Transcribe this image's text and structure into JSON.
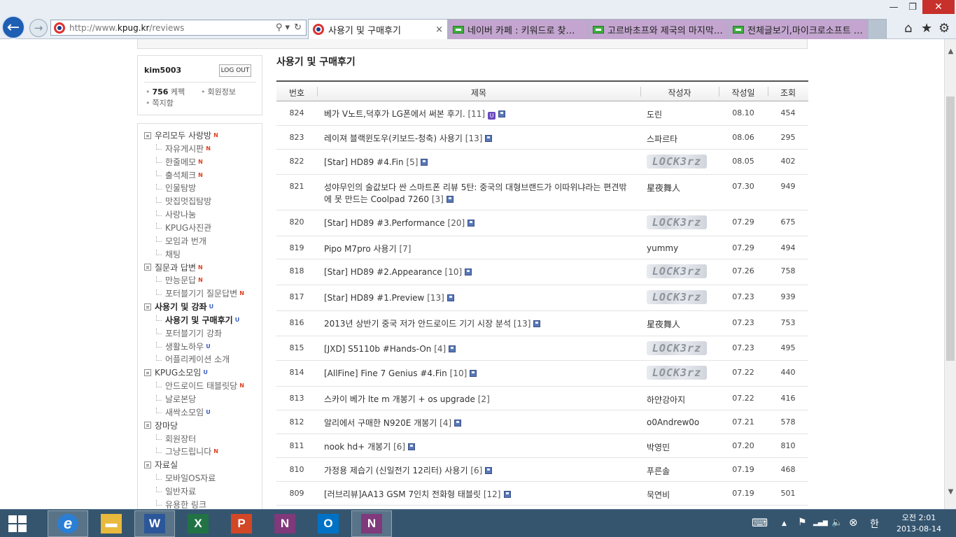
{
  "browser": {
    "url_prefix": "http://www.",
    "url_domain": "kpug.kr",
    "url_path": "/reviews",
    "addr_search_glyph": "⚲ ▾",
    "addr_refresh_glyph": "↻",
    "tabs": [
      {
        "label": "사용기 및 구매후기",
        "active": true,
        "close": "×"
      },
      {
        "label": "네이버 카페 : 키워드로 찾아라..."
      },
      {
        "label": "고르바초프와 제국의 마지막 : ..."
      },
      {
        "label": "전체글보기,마이크로소프트 공..."
      }
    ],
    "window_controls": {
      "minimize": "—",
      "maximize": "❐",
      "close": "✕"
    },
    "icons": {
      "home": "⌂",
      "favorites": "★",
      "tools": "⚙",
      "back": "←",
      "forward": "→"
    }
  },
  "login": {
    "username": "kim5003",
    "logout_label": "LOG OUT",
    "points_value": "756",
    "points_unit": " 케펙",
    "member_info": "회원정보",
    "messages": "쪽지함",
    "bullet": "•"
  },
  "sidebar": {
    "items": [
      {
        "label": "우리모두 사랑방",
        "badge": "N",
        "level": "group"
      },
      {
        "label": "자유게시판",
        "badge": "N",
        "level": "sub"
      },
      {
        "label": "한줄메모",
        "badge": "N",
        "level": "sub"
      },
      {
        "label": "출석체크",
        "badge": "N",
        "level": "sub"
      },
      {
        "label": "인물탐방",
        "badge": "",
        "level": "sub"
      },
      {
        "label": "맛집멋집탐방",
        "badge": "",
        "level": "sub"
      },
      {
        "label": "사랑나눔",
        "badge": "",
        "level": "sub"
      },
      {
        "label": "KPUG사진관",
        "badge": "",
        "level": "sub"
      },
      {
        "label": "모임과 번개",
        "badge": "",
        "level": "sub"
      },
      {
        "label": "채팅",
        "badge": "",
        "level": "sub"
      },
      {
        "label": "질문과 답변",
        "badge": "N",
        "level": "group"
      },
      {
        "label": "만능문답",
        "badge": "N",
        "level": "sub"
      },
      {
        "label": "포터블기기 질문답변",
        "badge": "N",
        "level": "sub"
      },
      {
        "label": "사용기 및 강좌",
        "badge": "U",
        "level": "group",
        "strong": true
      },
      {
        "label": "사용기 및 구매후기",
        "badge": "U",
        "level": "sub",
        "strong": true
      },
      {
        "label": "포터블기기 강좌",
        "badge": "",
        "level": "sub"
      },
      {
        "label": "생활노하우",
        "badge": "U",
        "level": "sub"
      },
      {
        "label": "어플리케이션 소개",
        "badge": "",
        "level": "sub"
      },
      {
        "label": "KPUG소모임",
        "badge": "U",
        "level": "group"
      },
      {
        "label": "안드로이드 태블릿당",
        "badge": "N",
        "level": "sub"
      },
      {
        "label": "날로본당",
        "badge": "",
        "level": "sub"
      },
      {
        "label": "새싹소모임",
        "badge": "U",
        "level": "sub"
      },
      {
        "label": "장마당",
        "badge": "",
        "level": "group"
      },
      {
        "label": "회원장터",
        "badge": "",
        "level": "sub"
      },
      {
        "label": "그냥드립니다",
        "badge": "N",
        "level": "sub"
      },
      {
        "label": "자료실",
        "badge": "",
        "level": "group"
      },
      {
        "label": "모바일OS자료",
        "badge": "",
        "level": "sub"
      },
      {
        "label": "일반자료",
        "badge": "",
        "level": "sub"
      },
      {
        "label": "유용한 링크",
        "badge": "",
        "level": "sub"
      }
    ]
  },
  "board": {
    "title": "사용기 및 구매후기",
    "columns": {
      "no": "번호",
      "subject": "제목",
      "author": "작성자",
      "date": "작성일",
      "views": "조회"
    },
    "rows": [
      {
        "no": "824",
        "subject": "베가 V노트,덕후가 LG폰에서 써본 후기.",
        "comments": "[11]",
        "ubadge": "U",
        "author": "도린",
        "date": "08.10",
        "views": "454"
      },
      {
        "no": "823",
        "subject": "레이져 블랙윈도우(키보드-청축) 사용기",
        "comments": "[13]",
        "author": "스파르타",
        "date": "08.06",
        "views": "295"
      },
      {
        "no": "822",
        "subject": "[Star] HD89 #4.Fin",
        "comments": "[5]",
        "author": "LOCK3rz",
        "author_img": true,
        "date": "08.05",
        "views": "402"
      },
      {
        "no": "821",
        "subject": "성야무인의 술값보다 싼 스마트폰 리뷰 5탄: 중국의 대형브랜드가 이따위냐라는 편견밖에 못 만드는 Coolpad 7260",
        "comments": "[3]",
        "author": "星夜舞人",
        "date": "07.30",
        "views": "949"
      },
      {
        "no": "820",
        "subject": "[Star] HD89 #3.Performance",
        "comments": "[20]",
        "author": "LOCK3rz",
        "author_img": true,
        "date": "07.29",
        "views": "675"
      },
      {
        "no": "819",
        "subject": "Pipo M7pro 사용기",
        "comments": "[7]",
        "author": "yummy",
        "date": "07.29",
        "views": "494",
        "nodisk": true
      },
      {
        "no": "818",
        "subject": "[Star] HD89 #2.Appearance",
        "comments": "[10]",
        "author": "LOCK3rz",
        "author_img": true,
        "date": "07.26",
        "views": "758"
      },
      {
        "no": "817",
        "subject": "[Star] HD89 #1.Preview",
        "comments": "[13]",
        "author": "LOCK3rz",
        "author_img": true,
        "date": "07.23",
        "views": "939"
      },
      {
        "no": "816",
        "subject": "2013년 상반기 중국 저가 안드로이드 기기 시장 분석",
        "comments": "[13]",
        "author": "星夜舞人",
        "date": "07.23",
        "views": "753"
      },
      {
        "no": "815",
        "subject": "[JXD] S5110b #Hands-On",
        "comments": "[4]",
        "author": "LOCK3rz",
        "author_img": true,
        "date": "07.23",
        "views": "495"
      },
      {
        "no": "814",
        "subject": "[AllFine] Fine 7 Genius #4.Fin",
        "comments": "[10]",
        "author": "LOCK3rz",
        "author_img": true,
        "date": "07.22",
        "views": "440"
      },
      {
        "no": "813",
        "subject": "스카이 베가 lte m 개봉기 + os upgrade",
        "comments": "[2]",
        "author": "하얀강아지",
        "date": "07.22",
        "views": "416",
        "nodisk": true
      },
      {
        "no": "812",
        "subject": "알리에서 구매한 N920E 개봉기",
        "comments": "[4]",
        "author": "o0Andrew0o",
        "date": "07.21",
        "views": "578"
      },
      {
        "no": "811",
        "subject": "nook hd+ 개봉기",
        "comments": "[6]",
        "author": "박영민",
        "date": "07.20",
        "views": "810"
      },
      {
        "no": "810",
        "subject": "가정용 제습기 (신일전기 12리터) 사용기",
        "comments": "[6]",
        "author": "푸른솔",
        "date": "07.19",
        "views": "468"
      },
      {
        "no": "809",
        "subject": "[러브리뷰]AA13 GSM 7인치 전화형 태블릿",
        "comments": "[12]",
        "author": "묵연비",
        "date": "07.19",
        "views": "501"
      }
    ]
  },
  "taskbar": {
    "apps": [
      {
        "name": "internet-explorer",
        "glyph": "e",
        "open": true,
        "color": "#2a7fd4"
      },
      {
        "name": "file-explorer",
        "glyph": "▬",
        "open": false,
        "color": "#e8b93c"
      },
      {
        "name": "word",
        "glyph": "W",
        "open": true,
        "color": "#2b579a"
      },
      {
        "name": "excel",
        "glyph": "X",
        "open": false,
        "color": "#217346"
      },
      {
        "name": "powerpoint",
        "glyph": "P",
        "open": false,
        "color": "#d24726"
      },
      {
        "name": "onenote",
        "glyph": "N",
        "open": false,
        "color": "#80397b"
      },
      {
        "name": "outlook",
        "glyph": "O",
        "open": false,
        "color": "#0072c6"
      },
      {
        "name": "onenote-clip",
        "glyph": "N",
        "open": true,
        "color": "#80397b"
      }
    ],
    "tray": {
      "keyboard": "⌨",
      "up": "▲",
      "flag": "⚑",
      "signal": "▂▄▆",
      "volume": "🔈",
      "close": "⊗",
      "ime": "한"
    },
    "clock_time": "오전 2:01",
    "clock_date": "2013-08-14"
  }
}
